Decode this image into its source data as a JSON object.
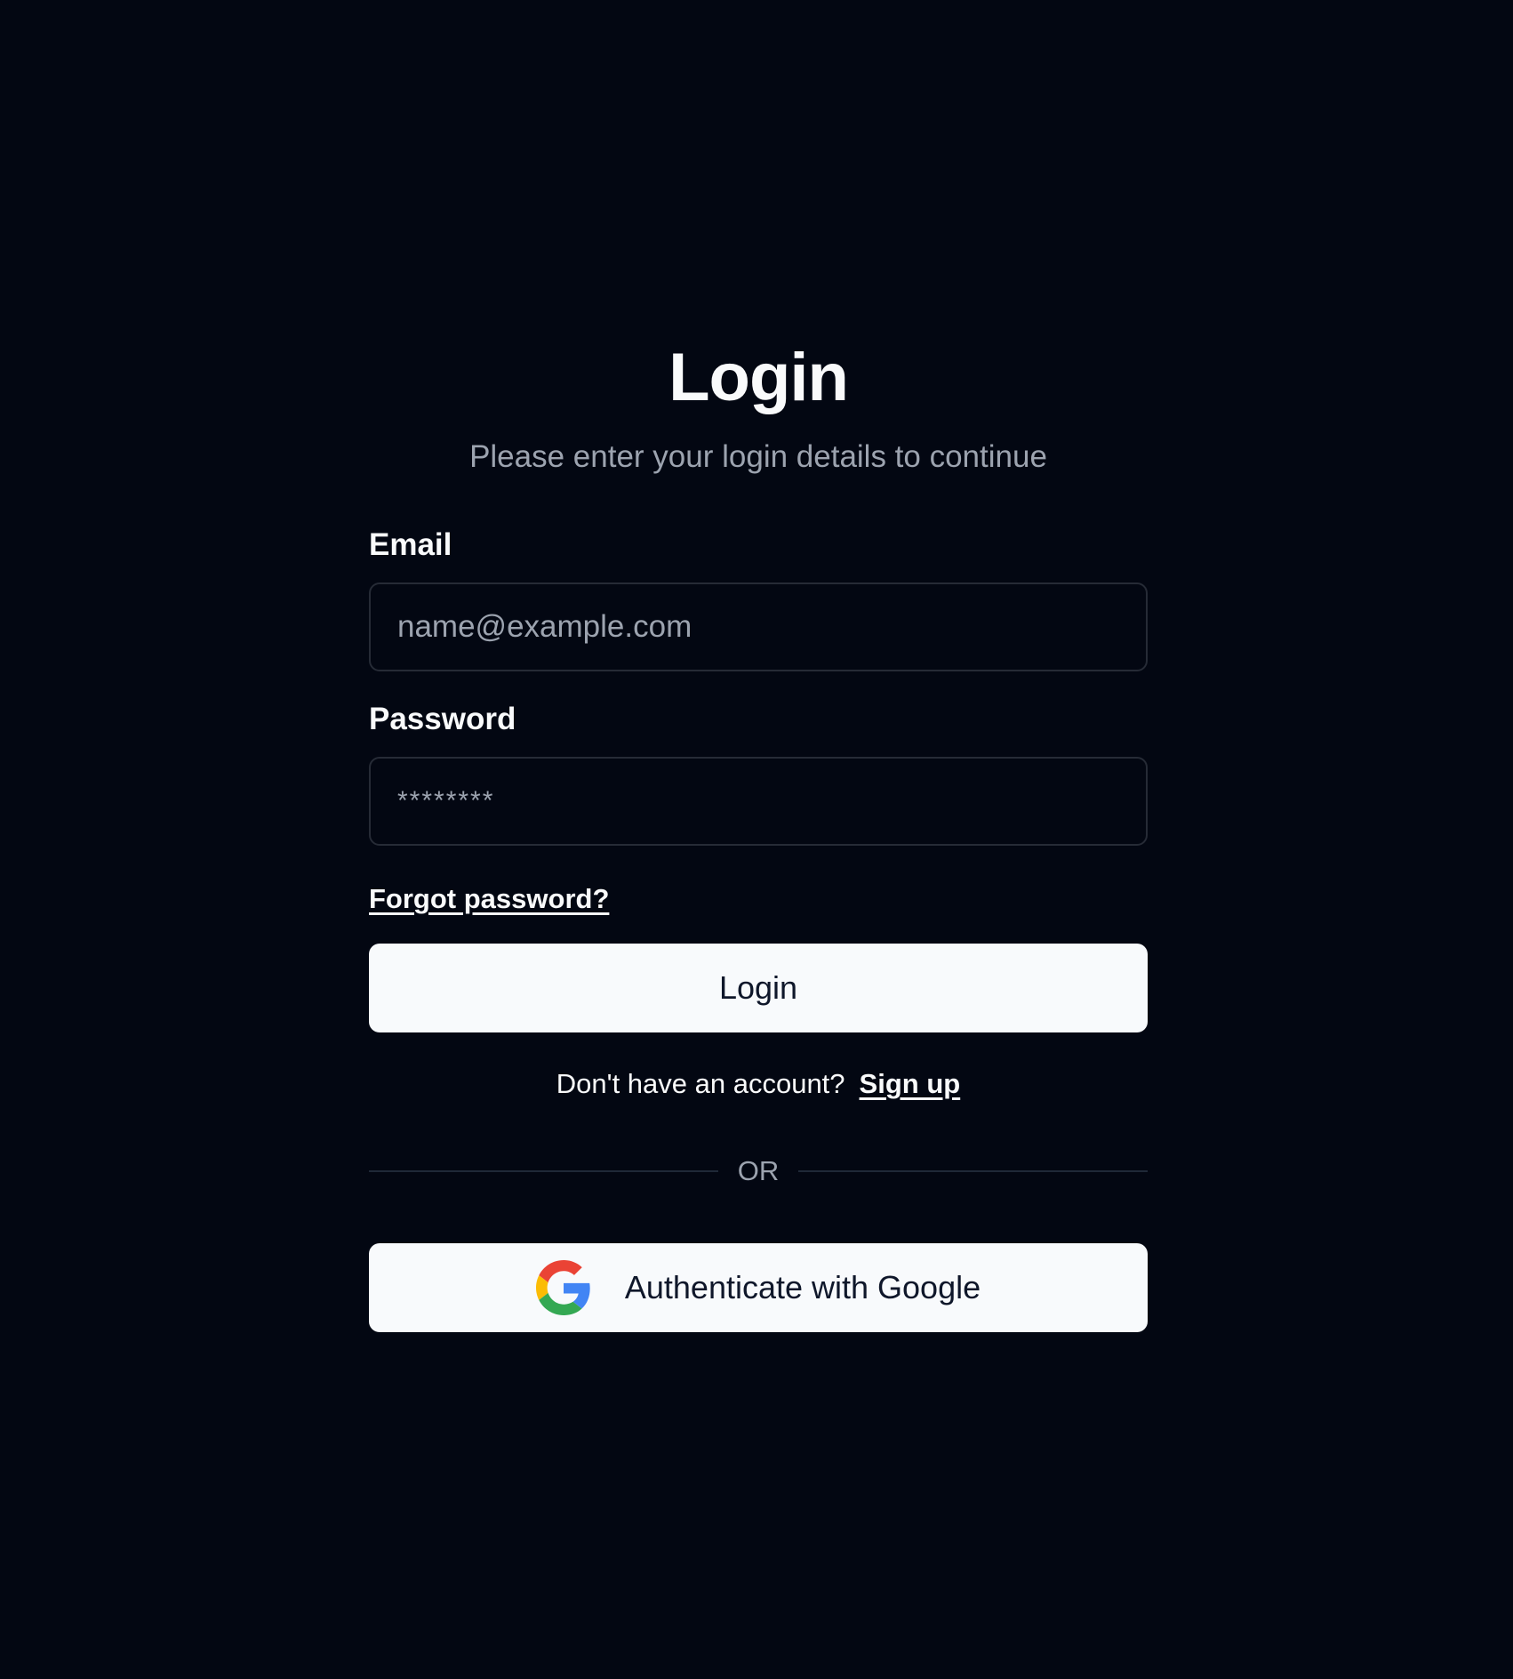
{
  "header": {
    "title": "Login",
    "subtitle": "Please enter your login details to continue"
  },
  "form": {
    "email_label": "Email",
    "email_placeholder": "name@example.com",
    "email_value": "",
    "password_label": "Password",
    "password_placeholder": "********",
    "forgot_link": "Forgot password?",
    "login_button": "Login"
  },
  "signup": {
    "prompt": "Don't have an account?",
    "link": "Sign up"
  },
  "divider": {
    "label": "OR"
  },
  "oauth": {
    "google_button": "Authenticate with Google",
    "icon": "google-icon"
  },
  "colors": {
    "background": "#030712",
    "button_bg": "#f8fafc",
    "muted_text": "#9ca3af",
    "border": "#262b36"
  }
}
